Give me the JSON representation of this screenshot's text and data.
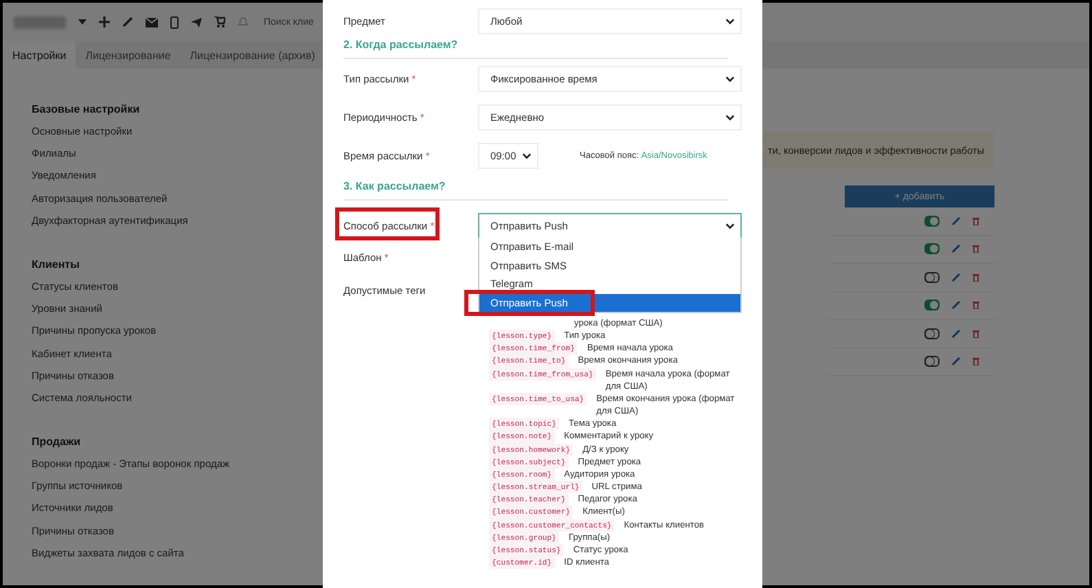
{
  "topbar": {
    "search_placeholder": "Поиск клие"
  },
  "tabs": [
    {
      "label": "Настройки",
      "selected": true
    },
    {
      "label": "Лицензирование",
      "selected": false
    },
    {
      "label": "Лицензирование (архив)",
      "selected": false
    }
  ],
  "sidebar": [
    {
      "title": "Базовые настройки",
      "items": [
        "Основные настройки",
        "Филиалы",
        "Уведомления",
        "Авторизация пользователей",
        "Двухфакторная аутентификация"
      ]
    },
    {
      "title": "Клиенты",
      "items": [
        "Статусы клиентов",
        "Уровни знаний",
        "Причины пропуска уроков",
        "Кабинет клиента",
        "Причины отказов",
        "Система лояльности"
      ]
    },
    {
      "title": "Продажи",
      "items": [
        "Воронки продаж - Этапы воронок продаж",
        "Группы источников",
        "Источники лидов",
        "Причины отказов",
        "Виджеты захвата лидов с сайта"
      ]
    }
  ],
  "main": {
    "notice": "ти, конверсии лидов и эффективности работы",
    "add_button": "+ добавить",
    "rows": [
      {
        "on": true
      },
      {
        "on": true
      },
      {
        "on": false
      },
      {
        "on": true
      },
      {
        "on": false
      },
      {
        "on": false
      }
    ]
  },
  "modal": {
    "subject": {
      "label": "Предмет",
      "value": "Любой"
    },
    "section_when": "2. Когда рассылаем?",
    "fields": [
      {
        "label": "Тип рассылки",
        "required_mark": "*",
        "value": "Фиксированное время"
      },
      {
        "label": "Периодичность",
        "required_mark": "*",
        "value": "Ежедневно"
      }
    ],
    "time": {
      "label": "Время рассылки",
      "required_mark": "*",
      "value": "09:00",
      "tz_label": "Часовой пояс:",
      "tz_value": "Asia/Novosibirsk"
    },
    "section_how": "3. Как рассылаем?",
    "method": {
      "label": "Способ рассылки",
      "required_mark": "*",
      "value": "Отправить Push",
      "highlighted": true,
      "options": [
        {
          "label": "Отправить E-mail",
          "selected": false,
          "highlighted": false
        },
        {
          "label": "Отправить SMS",
          "selected": false,
          "highlighted": false
        },
        {
          "label": "Telegram",
          "selected": false,
          "highlighted": false
        },
        {
          "label": "Отправить Push",
          "selected": true,
          "highlighted": true
        }
      ]
    },
    "template": {
      "label": "Шаблон",
      "required_mark": "*"
    },
    "tags_label": "Допустимые теги",
    "tags": [
      {
        "desc": "урока (формат США)"
      },
      {
        "code": "{lesson.type}",
        "desc": "Тип урока"
      },
      {
        "code": "{lesson.time_from}",
        "desc": "Время начала урока"
      },
      {
        "code": "{lesson.time_to}",
        "desc": "Время окончания урока"
      },
      {
        "code": "{lesson.time_from_usa}",
        "desc": "Время начала урока (формат для США)"
      },
      {
        "code": "{lesson.time_to_usa}",
        "desc": "Время окончания урока (формат для США)"
      },
      {
        "code": "{lesson.topic}",
        "desc": "Тема урока"
      },
      {
        "code": "{lesson.note}",
        "desc": "Комментарий к уроку"
      },
      {
        "code": "{lesson.homework}",
        "desc": "Д/З к уроку"
      },
      {
        "code": "{lesson.subject}",
        "desc": "Предмет урока"
      },
      {
        "code": "{lesson.room}",
        "desc": "Аудитория урока"
      },
      {
        "code": "{lesson.stream_url}",
        "desc": "URL стрима"
      },
      {
        "code": "{lesson.teacher}",
        "desc": "Педагог урока"
      },
      {
        "code": "{lesson.customer}",
        "desc": "Клиент(ы)"
      },
      {
        "code": "{lesson.customer_contacts}",
        "desc": "Контакты клиентов"
      },
      {
        "code": "{lesson.group}",
        "desc": "Группа(ы)"
      },
      {
        "code": "{lesson.status}",
        "desc": "Статус урока"
      },
      {
        "code": "{customer.id}",
        "desc": "ID клиента"
      }
    ]
  }
}
